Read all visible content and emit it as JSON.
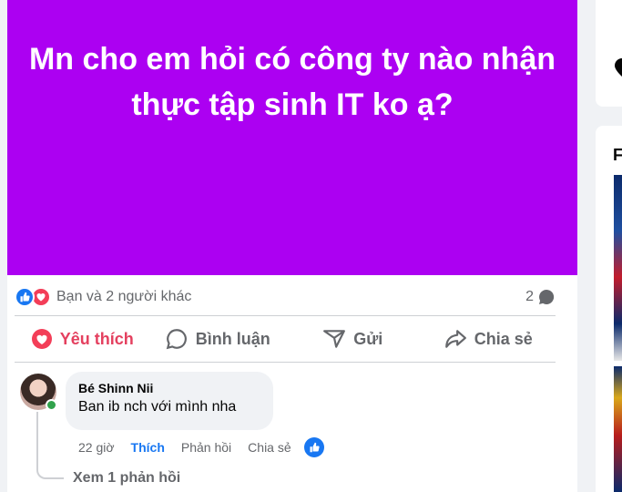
{
  "post": {
    "banner_text": "Mn cho em hỏi có công ty nào nhận thực tập sinh IT ko ạ?",
    "banner_color": "#ac00f2"
  },
  "reactions": {
    "summary": "Bạn và 2 người khác",
    "comment_count": "2"
  },
  "actions": {
    "like": "Yêu thích",
    "comment": "Bình luận",
    "send": "Gửi",
    "share": "Chia sẻ"
  },
  "comment": {
    "author": "Bé Shinn Nii",
    "text": "Ban ib nch với mình nha",
    "time": "22 giờ",
    "like": "Thích",
    "reply": "Phản hồi",
    "share": "Chia sẻ",
    "view_replies": "Xem 1 phản hồi"
  },
  "sidebar": {
    "letter": "F"
  },
  "colors": {
    "like_blue": "#1877f2",
    "love_red": "#f33e58",
    "liked_text": "#e4405f",
    "online_green": "#31a24c"
  }
}
